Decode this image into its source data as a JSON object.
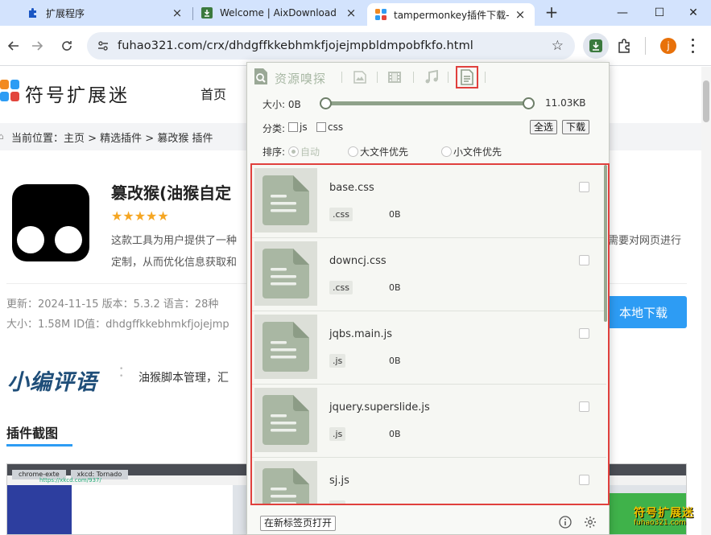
{
  "browser": {
    "tabs": [
      {
        "title": "扩展程序",
        "icon": "puzzle-icon",
        "active": false
      },
      {
        "title": "Welcome | AixDownload",
        "icon": "download-box-icon",
        "active": false
      },
      {
        "title": "tampermonkey插件下载-",
        "icon": "site-logo-icon",
        "active": true
      }
    ],
    "url": "fuhao321.com/crx/dhdgffkkebhmkfjojejmpbldmpobfkfo.html",
    "avatar_letter": "j"
  },
  "page": {
    "logo_text": "符号扩展迷",
    "nav_home": "首页",
    "breadcrumb": "当前位置：主页 > 精选插件 > 篡改猴 插件",
    "app_title": "篡改猴(油猴自定",
    "stars": "★★★★★",
    "desc_line1": "这款工具为用户提供了一种",
    "desc_line1_right": "需要对网页进行",
    "desc_line2": "定制，从而优化信息获取和",
    "meta_line1": "更新：2024-11-15    版本：5.3.2    语言：28种",
    "meta_line2": "大小：1.58M    ID值：dhdgffkkebhmkfjojejmp",
    "download_label": "本地下载",
    "review_logo": "小编评语",
    "review_text": "油猴脚本管理，汇",
    "shots_title": "插件截图",
    "watermark": "符号扩展迷",
    "watermark_url": "fuhao321.com"
  },
  "popup": {
    "brand": "资源嗅探",
    "size_label": "大小: 0B",
    "size_max": "11.03KB",
    "size_range_fraction": [
      0,
      1
    ],
    "category_label": "分类:",
    "categories": [
      {
        "label": "js",
        "checked": false
      },
      {
        "label": "css",
        "checked": false
      }
    ],
    "select_all": "全选",
    "download": "下载",
    "sort_label": "排序:",
    "sort_options": [
      {
        "label": "自动",
        "selected": true
      },
      {
        "label": "大文件优先",
        "selected": false
      },
      {
        "label": "小文件优先",
        "selected": false
      }
    ],
    "items": [
      {
        "name": "base.css",
        "ext": ".css",
        "size": "0B"
      },
      {
        "name": "downcj.css",
        "ext": ".css",
        "size": "0B"
      },
      {
        "name": "jqbs.main.js",
        "ext": ".js",
        "size": "0B"
      },
      {
        "name": "jquery.superslide.js",
        "ext": ".js",
        "size": "0B"
      },
      {
        "name": "sj.js",
        "ext": ".js",
        "size": "0B"
      }
    ],
    "open_in_tab": "在新标签页打开",
    "accent_red": "#e0403d",
    "accent_green": "#8fa28a"
  }
}
